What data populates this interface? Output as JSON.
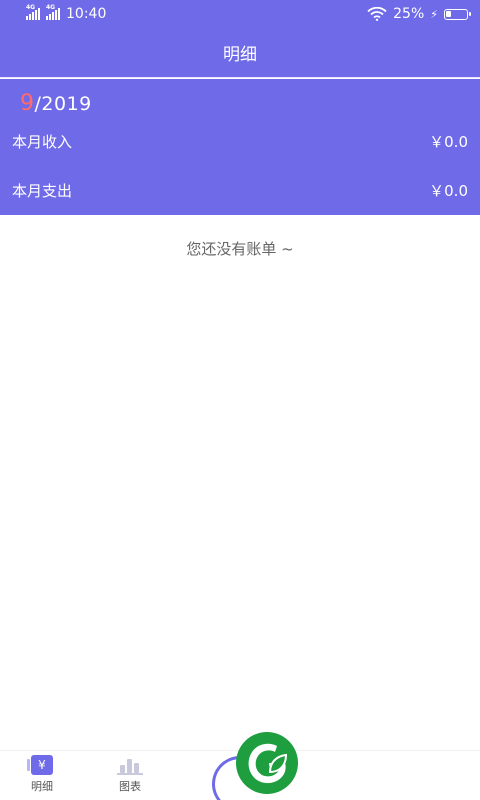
{
  "status_bar": {
    "network_1": "4G",
    "network_2": "4G",
    "time": "10:40",
    "battery_percent": "25%",
    "battery_level": 0.25
  },
  "header": {
    "title": "明细"
  },
  "summary": {
    "month": "9",
    "year": "/2019",
    "income_label": "本月收入",
    "income_value": "￥0.0",
    "expense_label": "本月支出",
    "expense_value": "￥0.0"
  },
  "empty_state": {
    "message": "您还没有账单 ~"
  },
  "tabbar": {
    "tab_bills_label": "明细",
    "tab_bills_icon_glyph": "¥",
    "tab_chart_label": "图表"
  },
  "colors": {
    "primary": "#6f6ae8",
    "month_highlight": "#ff6a6a",
    "logo_green": "#1e9e3e"
  },
  "icons": [
    "wifi-icon",
    "battery-icon",
    "charging-icon",
    "bill-icon",
    "chart-icon",
    "add-icon",
    "leaf-logo-icon"
  ]
}
